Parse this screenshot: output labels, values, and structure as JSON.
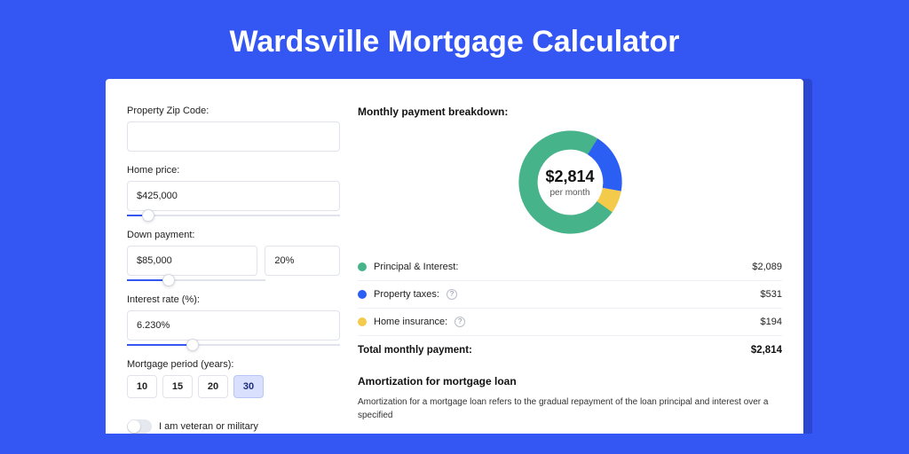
{
  "title": "Wardsville Mortgage Calculator",
  "colors": {
    "primary": "#3456f2",
    "green": "#47b38b",
    "yellow": "#f4ca4a",
    "blue": "#2b5ef2"
  },
  "form": {
    "zip": {
      "label": "Property Zip Code:",
      "value": ""
    },
    "price": {
      "label": "Home price:",
      "value": "$425,000",
      "slider_pct": 10
    },
    "down": {
      "label": "Down payment:",
      "value": "$85,000",
      "pct": "20%",
      "slider_pct": 20
    },
    "rate": {
      "label": "Interest rate (%):",
      "value": "6.230%",
      "slider_pct": 31
    },
    "period": {
      "label": "Mortgage period (years):",
      "options": [
        "10",
        "15",
        "20",
        "30"
      ],
      "selected": "30"
    },
    "veteran": {
      "label": "I am veteran or military",
      "on": false
    }
  },
  "breakdown": {
    "title": "Monthly payment breakdown:",
    "center_value": "$2,814",
    "center_sub": "per month",
    "rows": [
      {
        "swatch": "green",
        "label": "Principal & Interest:",
        "info": false,
        "value": "$2,089"
      },
      {
        "swatch": "blue",
        "label": "Property taxes:",
        "info": true,
        "value": "$531"
      },
      {
        "swatch": "yellow",
        "label": "Home insurance:",
        "info": true,
        "value": "$194"
      }
    ],
    "total_label": "Total monthly payment:",
    "total_value": "$2,814"
  },
  "amortization": {
    "title": "Amortization for mortgage loan",
    "body": "Amortization for a mortgage loan refers to the gradual repayment of the loan principal and interest over a specified"
  },
  "chart_data": {
    "type": "pie",
    "title": "Monthly payment breakdown",
    "series": [
      {
        "name": "Principal & Interest",
        "value": 2089,
        "color": "#47b38b"
      },
      {
        "name": "Property taxes",
        "value": 531,
        "color": "#2b5ef2"
      },
      {
        "name": "Home insurance",
        "value": 194,
        "color": "#f4ca4a"
      }
    ],
    "total": 2814,
    "angles_deg": [
      {
        "name": "Property taxes",
        "start": -58,
        "end": 10
      },
      {
        "name": "Home insurance",
        "start": 10,
        "end": 35
      },
      {
        "name": "Principal & Interest",
        "start": 35,
        "end": 302
      }
    ]
  }
}
